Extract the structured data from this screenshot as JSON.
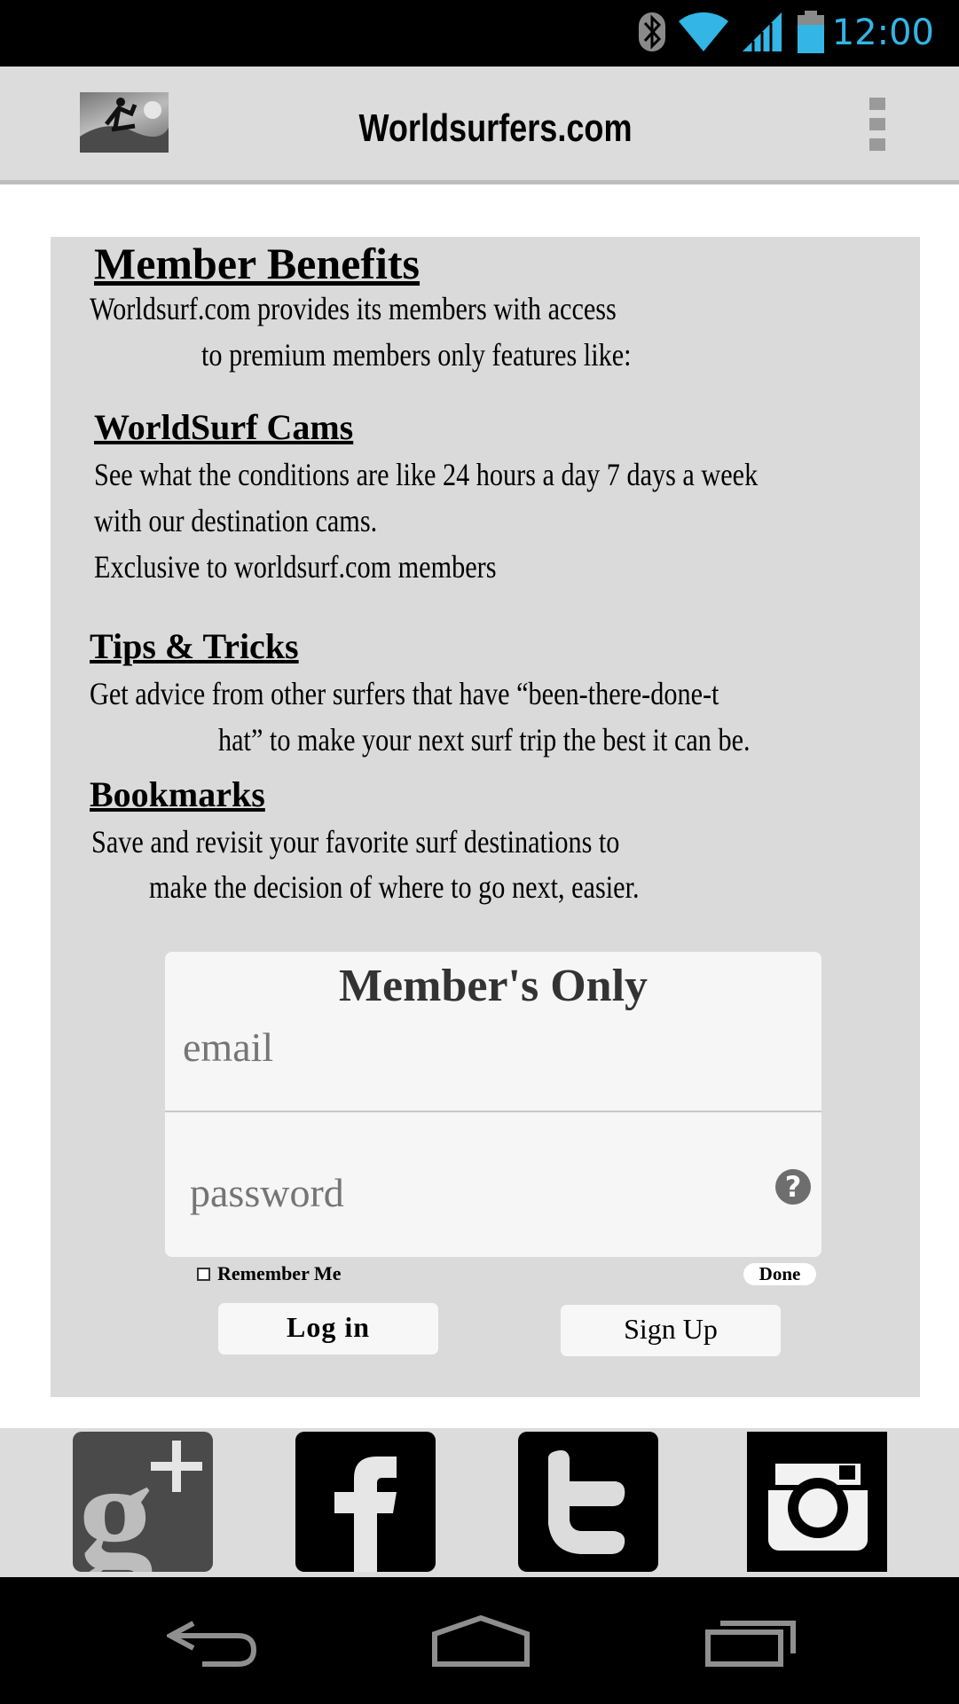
{
  "status_bar": {
    "time": "12:00",
    "icons": [
      "bluetooth-icon",
      "wifi-icon",
      "signal-icon",
      "battery-icon"
    ],
    "time_color": "#33b5e5"
  },
  "app_bar": {
    "title": "Worldsurfers.com",
    "logo": "surfer-photo",
    "menu_icon": "overflow-menu-icon"
  },
  "benefits": {
    "heading": "Member Benefits",
    "intro_line1": "Worldsurf.com provides its members with access",
    "intro_line2": "to premium members only features like:",
    "sections": [
      {
        "title": "WorldSurf Cams",
        "lines": [
          "See what the conditions are like 24 hours a day 7 days a week",
          "with our destination cams.",
          "Exclusive to worldsurf.com members"
        ]
      },
      {
        "title": "Tips & Tricks",
        "lines": [
          "Get advice from other surfers that have “been-there-done-t",
          "hat” to make your next surf trip the best it can be."
        ]
      },
      {
        "title": "Bookmarks",
        "lines": [
          "Save and revisit your favorite surf destinations to",
          "make the decision of where to go next, easier."
        ]
      }
    ]
  },
  "login": {
    "title": "Member's Only",
    "email_placeholder": "email",
    "password_placeholder": "password",
    "help_icon": "question-icon",
    "remember_label": "Remember Me",
    "done_label": "Done",
    "login_label": "Log in",
    "signup_label": "Sign Up"
  },
  "social": [
    "google-plus-icon",
    "facebook-icon",
    "twitter-icon",
    "instagram-icon"
  ],
  "nav": [
    "back-icon",
    "home-icon",
    "recents-icon"
  ]
}
